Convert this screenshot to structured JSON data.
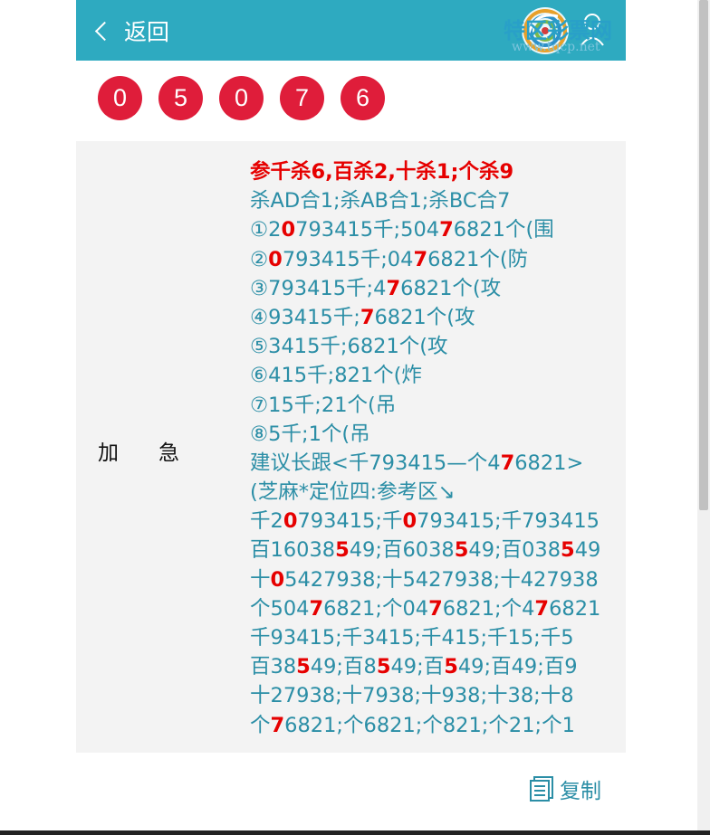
{
  "header": {
    "back_label": "返回"
  },
  "logo": {
    "name": "特区彩票网",
    "url": "www.tqcp.net"
  },
  "balls": [
    "0",
    "5",
    "0",
    "7",
    "6"
  ],
  "tag_label": "加急",
  "content_lines": [
    [
      [
        "参千杀6,百杀2,十杀1;个杀9",
        "first"
      ]
    ],
    [
      [
        "杀AD合1;杀AB合1;杀BC合7",
        ""
      ]
    ],
    [
      [
        "①2",
        ""
      ],
      [
        "0",
        "hot"
      ],
      [
        "793415千;504",
        ""
      ],
      [
        "7",
        "hot"
      ],
      [
        "6821个(围",
        ""
      ]
    ],
    [
      [
        "②",
        ""
      ],
      [
        "0",
        "hot"
      ],
      [
        "793415千;04",
        ""
      ],
      [
        "7",
        "hot"
      ],
      [
        "6821个(防",
        ""
      ]
    ],
    [
      [
        "③793415千;4",
        ""
      ],
      [
        "7",
        "hot"
      ],
      [
        "6821个(攻",
        ""
      ]
    ],
    [
      [
        "④93415千;",
        ""
      ],
      [
        "7",
        "hot"
      ],
      [
        "6821个(攻",
        ""
      ]
    ],
    [
      [
        "⑤3415千;6821个(攻",
        ""
      ]
    ],
    [
      [
        "⑥415千;821个(炸",
        ""
      ]
    ],
    [
      [
        "⑦15千;21个(吊",
        ""
      ]
    ],
    [
      [
        "⑧5千;1个(吊",
        ""
      ]
    ],
    [
      [
        "建议长跟<千793415—个4",
        ""
      ],
      [
        "7",
        "hot"
      ],
      [
        "6821>",
        ""
      ]
    ],
    [
      [
        "(芝麻*定位四:参考区↘",
        ""
      ]
    ],
    [
      [
        "千2",
        ""
      ],
      [
        "0",
        "hot"
      ],
      [
        "793415;千",
        ""
      ],
      [
        "0",
        "hot"
      ],
      [
        "793415;千793415",
        ""
      ]
    ],
    [
      [
        "百16038",
        ""
      ],
      [
        "5",
        "hot"
      ],
      [
        "49;百6038",
        ""
      ],
      [
        "5",
        "hot"
      ],
      [
        "49;百038",
        ""
      ],
      [
        "5",
        "hot"
      ],
      [
        "49",
        ""
      ]
    ],
    [
      [
        "十",
        ""
      ],
      [
        "0",
        "hot"
      ],
      [
        "5427938;十5427938;十427938",
        ""
      ]
    ],
    [
      [
        "个504",
        ""
      ],
      [
        "7",
        "hot"
      ],
      [
        "6821;个04",
        ""
      ],
      [
        "7",
        "hot"
      ],
      [
        "6821;个4",
        ""
      ],
      [
        "7",
        "hot"
      ],
      [
        "6821",
        ""
      ]
    ],
    [
      [
        "千93415;千3415;千415;千15;千5",
        ""
      ]
    ],
    [
      [
        "百38",
        ""
      ],
      [
        "5",
        "hot"
      ],
      [
        "49;百8",
        ""
      ],
      [
        "5",
        "hot"
      ],
      [
        "49;百",
        ""
      ],
      [
        "5",
        "hot"
      ],
      [
        "49;百49;百9",
        ""
      ]
    ],
    [
      [
        "十27938;十7938;十938;十38;十8",
        ""
      ]
    ],
    [
      [
        "个",
        ""
      ],
      [
        "7",
        "hot"
      ],
      [
        "6821;个6821;个821;个21;个1",
        ""
      ]
    ]
  ],
  "copy_label": "复制",
  "colors": {
    "header_bg": "#2eaac0",
    "ball_bg": "#df1d3a",
    "text_teal": "#2b8ea6",
    "highlight_red": "#e60000",
    "panel_bg": "#f3f3f3"
  }
}
